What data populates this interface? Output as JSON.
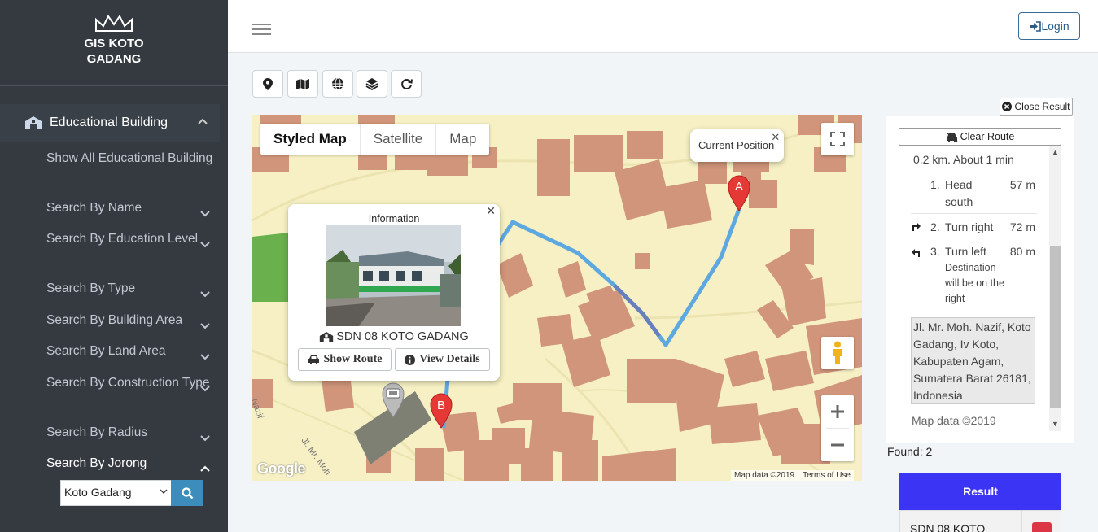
{
  "brand": {
    "line1": "GIS KOTO",
    "line2": "GADANG"
  },
  "sidebar": {
    "main_item": "Educational Building",
    "items": [
      {
        "label": "Show All Educational Building"
      },
      {
        "label": "Search By Name"
      },
      {
        "label": "Search By Education Level"
      },
      {
        "label": "Search By Type"
      },
      {
        "label": "Search By Building Area"
      },
      {
        "label": "Search By Land Area"
      },
      {
        "label": "Search By Construction Type"
      },
      {
        "label": "Search By Radius"
      },
      {
        "label": "Search By Jorong"
      }
    ],
    "jorong_select": "Koto Gadang"
  },
  "topbar": {
    "login_label": "Login"
  },
  "toolbar": {
    "icons": [
      "location-marker-icon",
      "map-icon",
      "globe-icon",
      "layers-icon",
      "refresh-icon"
    ]
  },
  "map": {
    "types": [
      "Styled Map",
      "Satellite",
      "Map"
    ],
    "active_type": "Styled Map",
    "current_position_label": "Current Position",
    "marker_a": "A",
    "marker_b": "B",
    "street_1": "Jl. Mr. Moh",
    "street_2": "Nazif",
    "logo": "Google",
    "map_data": "Map data ©2019",
    "terms": "Terms of Use",
    "info": {
      "title": "Information",
      "name": "SDN 08 KOTO GADANG",
      "show_route": "Show Route",
      "view_details": "View Details"
    }
  },
  "directions": {
    "close_result": "Close Result",
    "clear_route": "Clear Route",
    "summary": "0.2 km. About 1 min",
    "steps": [
      {
        "num": "1.",
        "text": "Head",
        "bold": "south",
        "note": "",
        "dist": "57 m"
      },
      {
        "num": "2.",
        "text": "Turn",
        "bold": "right",
        "note": "",
        "dist": "72 m"
      },
      {
        "num": "3.",
        "text": "Turn",
        "bold": "left",
        "note": "Destination will be on the right",
        "dist": "80 m"
      }
    ],
    "address": "Jl. Mr. Moh. Nazif, Koto Gadang, Iv Koto, Kabupaten Agam, Sumatera Barat 26181, Indonesia",
    "map_data": "Map data ©2019"
  },
  "results": {
    "found": "Found: 2",
    "header": "Result",
    "rows": [
      {
        "name": "SDN 08 KOTO"
      }
    ]
  },
  "colors": {
    "sidebar": "#343a40",
    "route": "#5ea8e0",
    "building": "#d0957a",
    "map_bg": "#f6f0c4",
    "result_header": "#3c34f5",
    "marker": "#e53935"
  }
}
